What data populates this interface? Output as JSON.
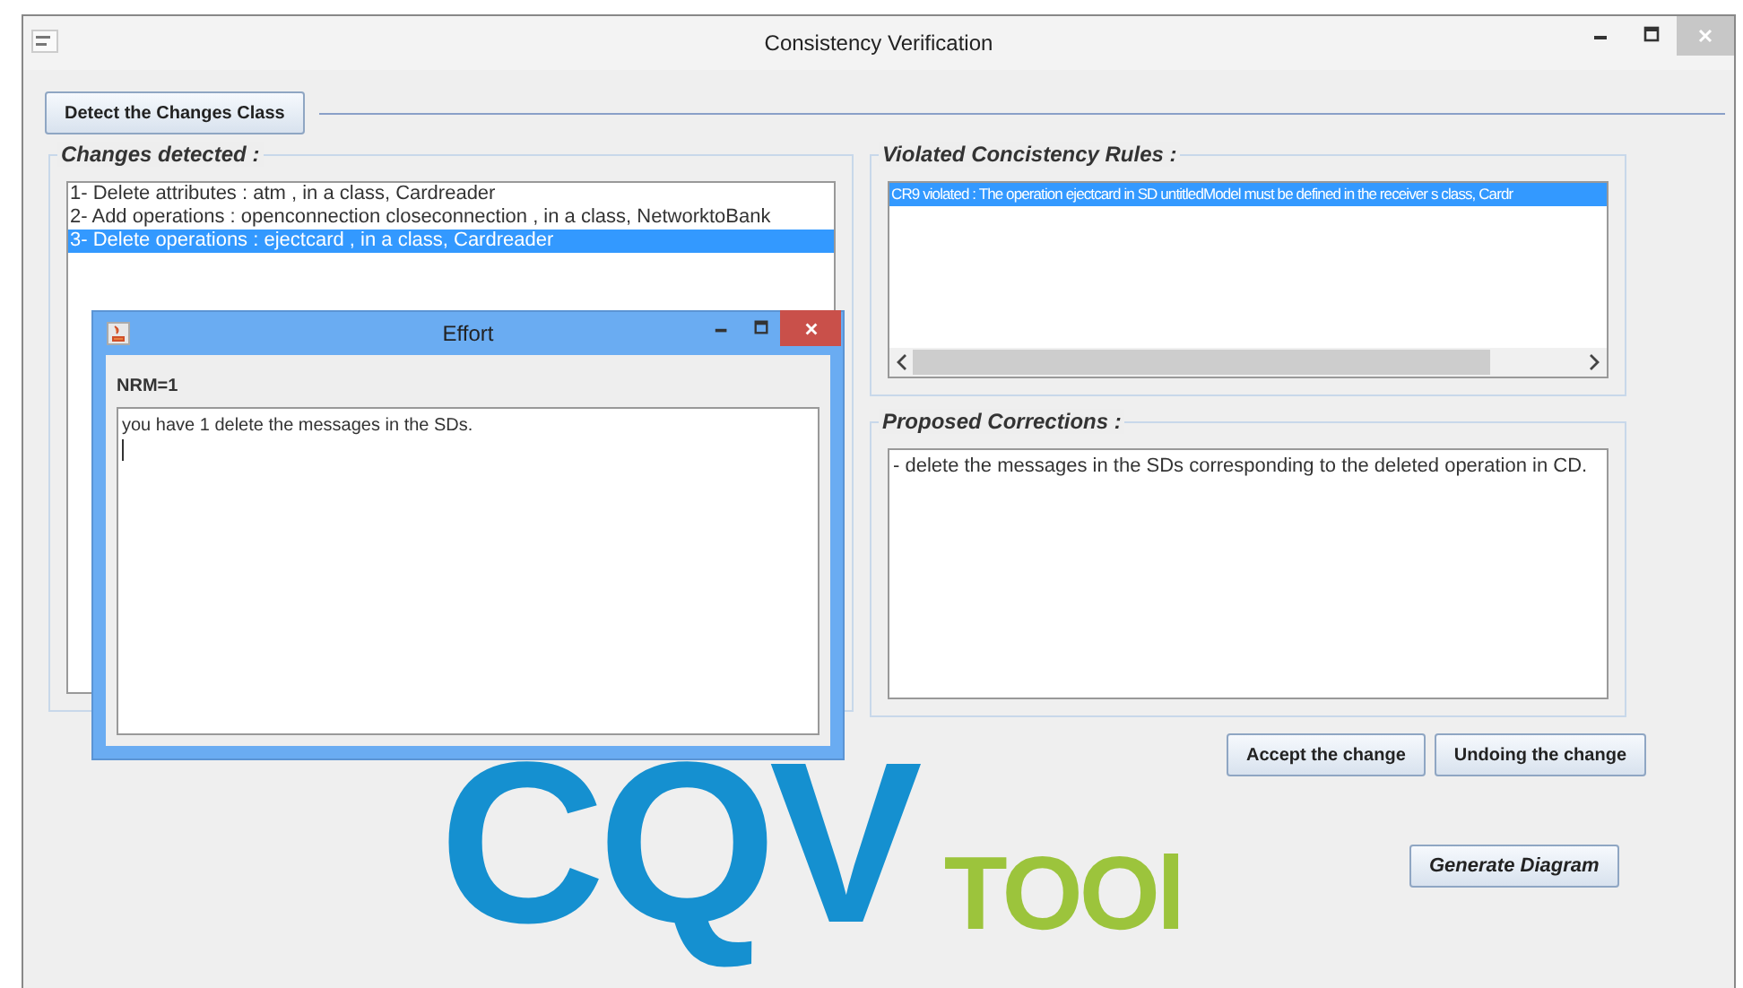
{
  "window": {
    "title": "Consistency Verification"
  },
  "detect_button": {
    "label": "Detect the Changes Class"
  },
  "changes_panel": {
    "title": "Changes detected :",
    "items": [
      {
        "text": "1- Delete attributes : atm , in a class, Cardreader",
        "selected": false
      },
      {
        "text": "2- Add operations : openconnection closeconnection , in a class, NetworktoBank",
        "selected": false
      },
      {
        "text": "3- Delete operations : ejectcard , in a class, Cardreader",
        "selected": true
      }
    ]
  },
  "violated_panel": {
    "title": "Violated Concistency Rules :",
    "items": [
      {
        "text": "CR9 violated : The operation ejectcard in SD untitledModel must be defined in the receiver s class, Cardr",
        "selected": true
      }
    ]
  },
  "corrections_panel": {
    "title": "Proposed Corrections :",
    "text": "- delete the messages in the SDs corresponding to the deleted operation in CD."
  },
  "action_buttons": [
    {
      "label": "Accept the change"
    },
    {
      "label": "Undoing the change"
    }
  ],
  "logo": {
    "main": "CQV",
    "sub": "TOOl"
  },
  "generate_button": {
    "label": "Generate Diagram"
  },
  "dialog": {
    "title": "Effort",
    "metric": "NRM=1",
    "text": "you have 1 delete the messages in the SDs."
  }
}
